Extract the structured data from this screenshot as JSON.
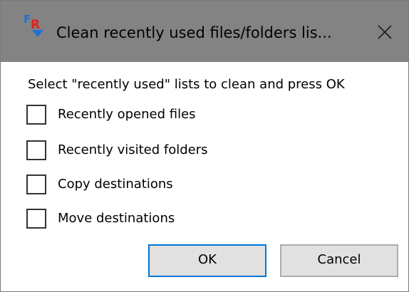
{
  "window": {
    "title": "Clean recently used files/folders lis...",
    "app_icon": "fr-app-logo",
    "close_icon": "close-icon"
  },
  "dialog": {
    "prompt": "Select \"recently used\" lists to clean and press OK",
    "options": [
      {
        "label": "Recently opened files",
        "checked": false
      },
      {
        "label": "Recently visited folders",
        "checked": false
      },
      {
        "label": "Copy destinations",
        "checked": false
      },
      {
        "label": "Move destinations",
        "checked": false
      }
    ],
    "ok_label": "OK",
    "cancel_label": "Cancel"
  },
  "colors": {
    "titlebar": "#838383",
    "default_button_border": "#0078d7",
    "icon_red": "#e02020",
    "icon_blue": "#1e6fd9"
  }
}
